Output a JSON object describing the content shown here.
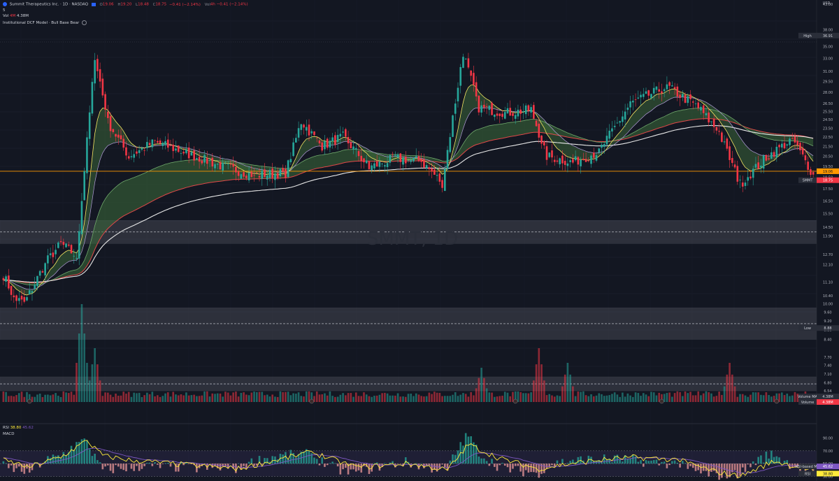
{
  "header": {
    "symbol_title": "Summit Therapeutics Inc. · 1D · NASDAQ",
    "ohlc": {
      "o_label": "O",
      "o": "19.06",
      "h_label": "H",
      "h": "19.20",
      "l_label": "L",
      "l": "18.48",
      "c_label": "C",
      "c": "18.75",
      "change": "−0.41 (−2.14%)",
      "vol_label": "Vol",
      "vol_change": "4h −0.41 (−2.14%)"
    },
    "line2": "5",
    "vol_line_label": "Vol",
    "vol_line_extra": "4M",
    "vol_value": "4.38M",
    "indicator_label": "Institutional DCF Model · Bull Base Bear"
  },
  "price_axis": {
    "currency": "USD",
    "ticks": [
      "43.00",
      "38.00",
      "35.00",
      "33.00",
      "31.00",
      "29.50",
      "28.00",
      "26.50",
      "25.50",
      "24.50",
      "23.50",
      "22.50",
      "21.50",
      "20.50",
      "19.50",
      "18.50",
      "17.50",
      "16.50",
      "15.50",
      "14.50",
      "13.90",
      "12.70",
      "12.10",
      "11.10",
      "10.40",
      "10.00",
      "9.60",
      "9.20",
      "8.80",
      "8.40",
      "7.70",
      "7.40",
      "7.10",
      "6.80",
      "6.54"
    ],
    "high_label": "High",
    "high_value": "36.91",
    "low_label": "Low",
    "low_value": "8.88",
    "orange_level_value": "19.06",
    "last_label": "SMMT",
    "last_value": "18.75",
    "ma_label": "Volume MA",
    "ma_value": "4.38M",
    "volume_label": "Volume",
    "volume_value": "4.38M"
  },
  "watermark": "SMMT, 1D",
  "rsi_pane": {
    "title": "RSI",
    "value": "38.80",
    "ma_value": "45.62",
    "macd_title": "MACD",
    "axis_ticks": [
      "90.00",
      "70.00",
      "50.00",
      "30.00"
    ],
    "tag_ma_label": "RSI-based MA",
    "tag_ma_value": "45.62",
    "tag_rsi_label": "RSI",
    "tag_rsi_value": "38.80"
  },
  "colors": {
    "background": "#131722",
    "up": "#26a69a",
    "down": "#f23645",
    "ribbon_fill": "#3d6b3a",
    "ema_fast": "#f5e663",
    "sma_long": "#e8e8e8",
    "orange_level": "#ff9800",
    "rsi_line": "#ffeb3b",
    "rsi_ma": "#7e57c2"
  },
  "chart_data": {
    "type": "candlestick",
    "interval": "1D",
    "price_scale": {
      "min": 6.3,
      "max": 43,
      "log": true
    },
    "zones": [
      [
        13.4,
        15.0
      ],
      [
        8.4,
        9.8
      ],
      [
        6.54,
        7.0
      ]
    ],
    "horizontal_level": 19.06,
    "ohlc_anchor_bars": [
      {
        "bar": 0,
        "price": 11.5
      },
      {
        "bar": 4,
        "price": 10.3
      },
      {
        "bar": 8,
        "price": 10.0
      },
      {
        "bar": 16,
        "price": 12.2
      },
      {
        "bar": 22,
        "price": 13.4
      },
      {
        "bar": 28,
        "price": 12.6
      },
      {
        "bar": 32,
        "price": 22.0
      },
      {
        "bar": 35,
        "price": 33.5
      },
      {
        "bar": 40,
        "price": 24.2
      },
      {
        "bar": 48,
        "price": 20.5
      },
      {
        "bar": 58,
        "price": 22.0
      },
      {
        "bar": 70,
        "price": 20.8
      },
      {
        "bar": 84,
        "price": 19.5
      },
      {
        "bar": 96,
        "price": 18.7
      },
      {
        "bar": 108,
        "price": 18.9
      },
      {
        "bar": 114,
        "price": 24.3
      },
      {
        "bar": 122,
        "price": 21.5
      },
      {
        "bar": 130,
        "price": 22.6
      },
      {
        "bar": 140,
        "price": 19.4
      },
      {
        "bar": 150,
        "price": 20.3
      },
      {
        "bar": 160,
        "price": 20.0
      },
      {
        "bar": 168,
        "price": 18.0
      },
      {
        "bar": 176,
        "price": 34.0
      },
      {
        "bar": 182,
        "price": 26.0
      },
      {
        "bar": 192,
        "price": 25.3
      },
      {
        "bar": 202,
        "price": 25.7
      },
      {
        "bar": 208,
        "price": 20.5
      },
      {
        "bar": 218,
        "price": 19.9
      },
      {
        "bar": 228,
        "price": 21.0
      },
      {
        "bar": 240,
        "price": 26.5
      },
      {
        "bar": 254,
        "price": 28.8
      },
      {
        "bar": 266,
        "price": 26.0
      },
      {
        "bar": 274,
        "price": 23.0
      },
      {
        "bar": 282,
        "price": 17.9
      },
      {
        "bar": 292,
        "price": 20.4
      },
      {
        "bar": 302,
        "price": 22.3
      },
      {
        "bar": 310,
        "price": 18.75
      }
    ],
    "bar_count": 311,
    "volume_peaks": [
      {
        "bar": 30,
        "rel": 1.0
      },
      {
        "bar": 35,
        "rel": 0.55
      },
      {
        "bar": 183,
        "rel": 0.35
      },
      {
        "bar": 205,
        "rel": 0.55
      },
      {
        "bar": 216,
        "rel": 0.4
      },
      {
        "bar": 278,
        "rel": 0.4
      }
    ],
    "rsi_anchor": [
      {
        "bar": 0,
        "v": 55
      },
      {
        "bar": 10,
        "v": 45
      },
      {
        "bar": 22,
        "v": 60
      },
      {
        "bar": 32,
        "v": 86
      },
      {
        "bar": 38,
        "v": 62
      },
      {
        "bar": 50,
        "v": 55
      },
      {
        "bar": 70,
        "v": 48
      },
      {
        "bar": 90,
        "v": 42
      },
      {
        "bar": 118,
        "v": 68
      },
      {
        "bar": 135,
        "v": 44
      },
      {
        "bar": 155,
        "v": 50
      },
      {
        "bar": 170,
        "v": 40
      },
      {
        "bar": 178,
        "v": 80
      },
      {
        "bar": 190,
        "v": 58
      },
      {
        "bar": 205,
        "v": 42
      },
      {
        "bar": 220,
        "v": 52
      },
      {
        "bar": 240,
        "v": 60
      },
      {
        "bar": 258,
        "v": 56
      },
      {
        "bar": 272,
        "v": 38
      },
      {
        "bar": 282,
        "v": 30
      },
      {
        "bar": 295,
        "v": 54
      },
      {
        "bar": 310,
        "v": 38.8
      }
    ]
  }
}
